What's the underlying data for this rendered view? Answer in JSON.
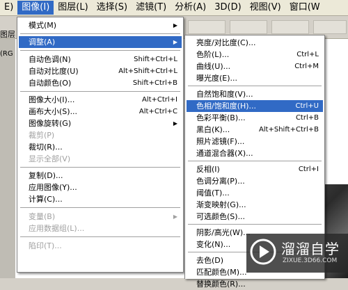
{
  "menubar": {
    "items": [
      "E)",
      "图像(I)",
      "图层(L)",
      "选择(S)",
      "滤镜(T)",
      "分析(A)",
      "3D(D)",
      "视图(V)",
      "窗口(W"
    ],
    "active_index": 1
  },
  "toolbar": {
    "left_label": "图层"
  },
  "leftstrip": {
    "label": "(RG"
  },
  "image_menu": {
    "items": [
      {
        "label": "模式(M)",
        "shortcut": "",
        "submenu": true,
        "enabled": true
      },
      {
        "label": "调整(A)",
        "shortcut": "",
        "submenu": true,
        "enabled": true,
        "highlighted": true
      },
      {
        "label": "自动色调(N)",
        "shortcut": "Shift+Ctrl+L",
        "enabled": true
      },
      {
        "label": "自动对比度(U)",
        "shortcut": "Alt+Shift+Ctrl+L",
        "enabled": true
      },
      {
        "label": "自动颜色(O)",
        "shortcut": "Shift+Ctrl+B",
        "enabled": true
      },
      {
        "label": "图像大小(I)...",
        "shortcut": "Alt+Ctrl+I",
        "enabled": true
      },
      {
        "label": "画布大小(S)...",
        "shortcut": "Alt+Ctrl+C",
        "enabled": true
      },
      {
        "label": "图像旋转(G)",
        "shortcut": "",
        "submenu": true,
        "enabled": true
      },
      {
        "label": "裁剪(P)",
        "shortcut": "",
        "enabled": false
      },
      {
        "label": "裁切(R)...",
        "shortcut": "",
        "enabled": true
      },
      {
        "label": "显示全部(V)",
        "shortcut": "",
        "enabled": false
      },
      {
        "label": "复制(D)...",
        "shortcut": "",
        "enabled": true
      },
      {
        "label": "应用图像(Y)...",
        "shortcut": "",
        "enabled": true
      },
      {
        "label": "计算(C)...",
        "shortcut": "",
        "enabled": true
      },
      {
        "label": "变量(B)",
        "shortcut": "",
        "submenu": true,
        "enabled": false
      },
      {
        "label": "应用数据组(L)...",
        "shortcut": "",
        "enabled": false
      },
      {
        "label": "陷印(T)...",
        "shortcut": "",
        "enabled": false
      }
    ]
  },
  "adjust_menu": {
    "items": [
      {
        "label": "亮度/对比度(C)...",
        "shortcut": ""
      },
      {
        "label": "色阶(L)...",
        "shortcut": "Ctrl+L"
      },
      {
        "label": "曲线(U)...",
        "shortcut": "Ctrl+M"
      },
      {
        "label": "曝光度(E)...",
        "shortcut": ""
      },
      {
        "label": "自然饱和度(V)...",
        "shortcut": ""
      },
      {
        "label": "色相/饱和度(H)...",
        "shortcut": "Ctrl+U",
        "highlighted": true
      },
      {
        "label": "色彩平衡(B)...",
        "shortcut": "Ctrl+B"
      },
      {
        "label": "黑白(K)...",
        "shortcut": "Alt+Shift+Ctrl+B"
      },
      {
        "label": "照片滤镜(F)...",
        "shortcut": ""
      },
      {
        "label": "通道混合器(X)...",
        "shortcut": ""
      },
      {
        "label": "反相(I)",
        "shortcut": "Ctrl+I"
      },
      {
        "label": "色调分离(P)...",
        "shortcut": ""
      },
      {
        "label": "阈值(T)...",
        "shortcut": ""
      },
      {
        "label": "渐变映射(G)...",
        "shortcut": ""
      },
      {
        "label": "可选颜色(S)...",
        "shortcut": ""
      },
      {
        "label": "阴影/高光(W)...",
        "shortcut": ""
      },
      {
        "label": "变化(N)...",
        "shortcut": ""
      },
      {
        "label": "去色(D)",
        "shortcut": ""
      },
      {
        "label": "匹配颜色(M)...",
        "shortcut": ""
      },
      {
        "label": "替换颜色(R)...",
        "shortcut": ""
      }
    ]
  },
  "watermark": {
    "title": "溜溜自学",
    "url": "ZIXUE.3D66.COM"
  },
  "colors": {
    "highlight": "#316ac5",
    "disabled": "#a0a0a0",
    "menu_bg": "#ffffff"
  }
}
